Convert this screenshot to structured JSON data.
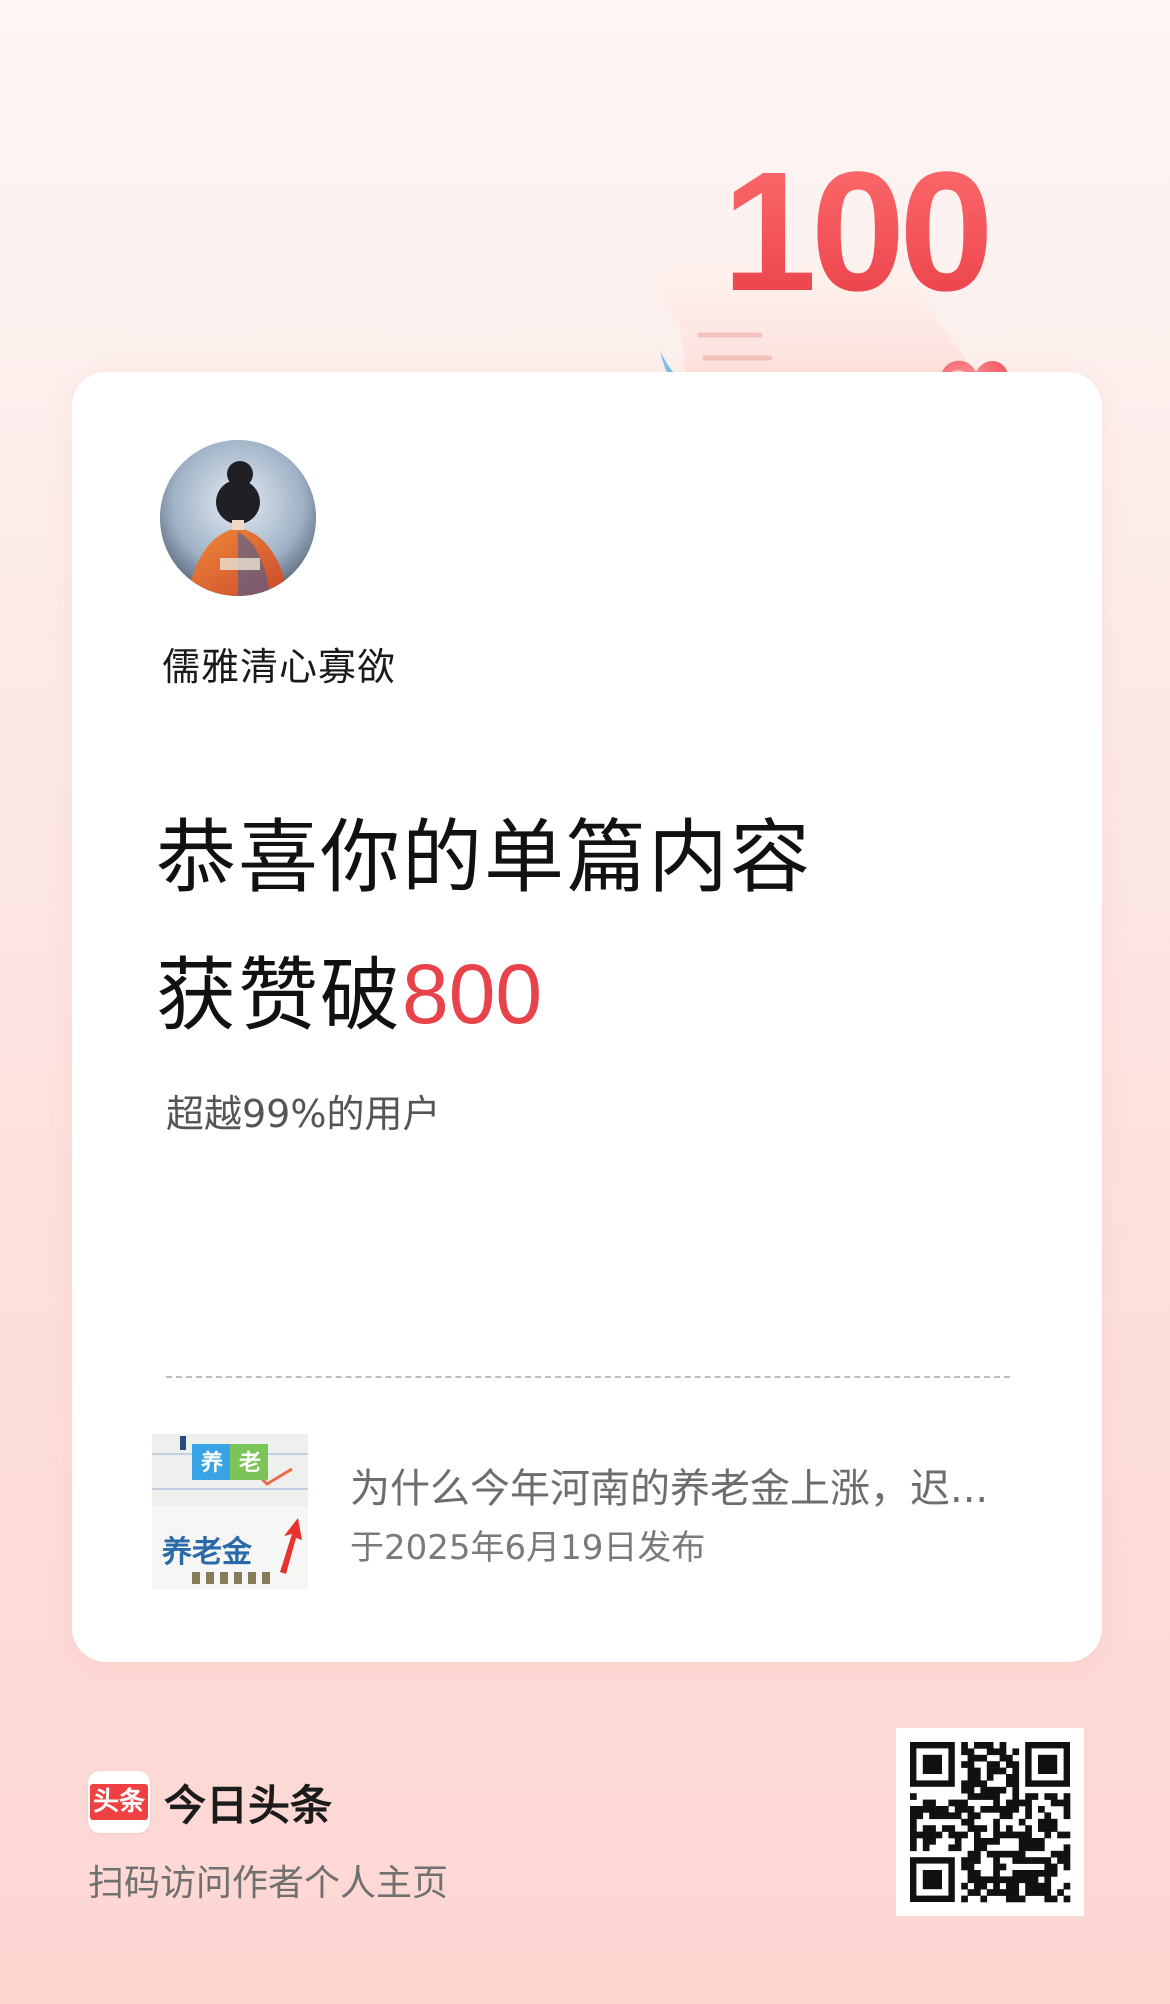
{
  "badge": {
    "number": "100"
  },
  "profile": {
    "username": "儒雅清心寡欲"
  },
  "achievement": {
    "line1": "恭喜你的单篇内容",
    "line2_prefix": "获赞破",
    "line2_number": "800",
    "rank_text": "超越99%的用户"
  },
  "article": {
    "title": "为什么今年河南的养老金上涨，迟...",
    "date_text": "于2025年6月19日发布",
    "thumb_tag": "养老",
    "thumb_title": "养老金"
  },
  "footer": {
    "logo_text": "头条",
    "brand_name": "今日头条",
    "scan_hint": "扫码访问作者个人主页"
  },
  "colors": {
    "accent": "#e8424a",
    "brand_red": "#f04142",
    "background_top": "#fdf6f4",
    "background_bottom": "#fdd6d2"
  },
  "icons": {
    "badge": "trophy-100-scroll-heart-icon",
    "qr": "qr-code-icon",
    "logo": "toutiao-logo-icon"
  }
}
